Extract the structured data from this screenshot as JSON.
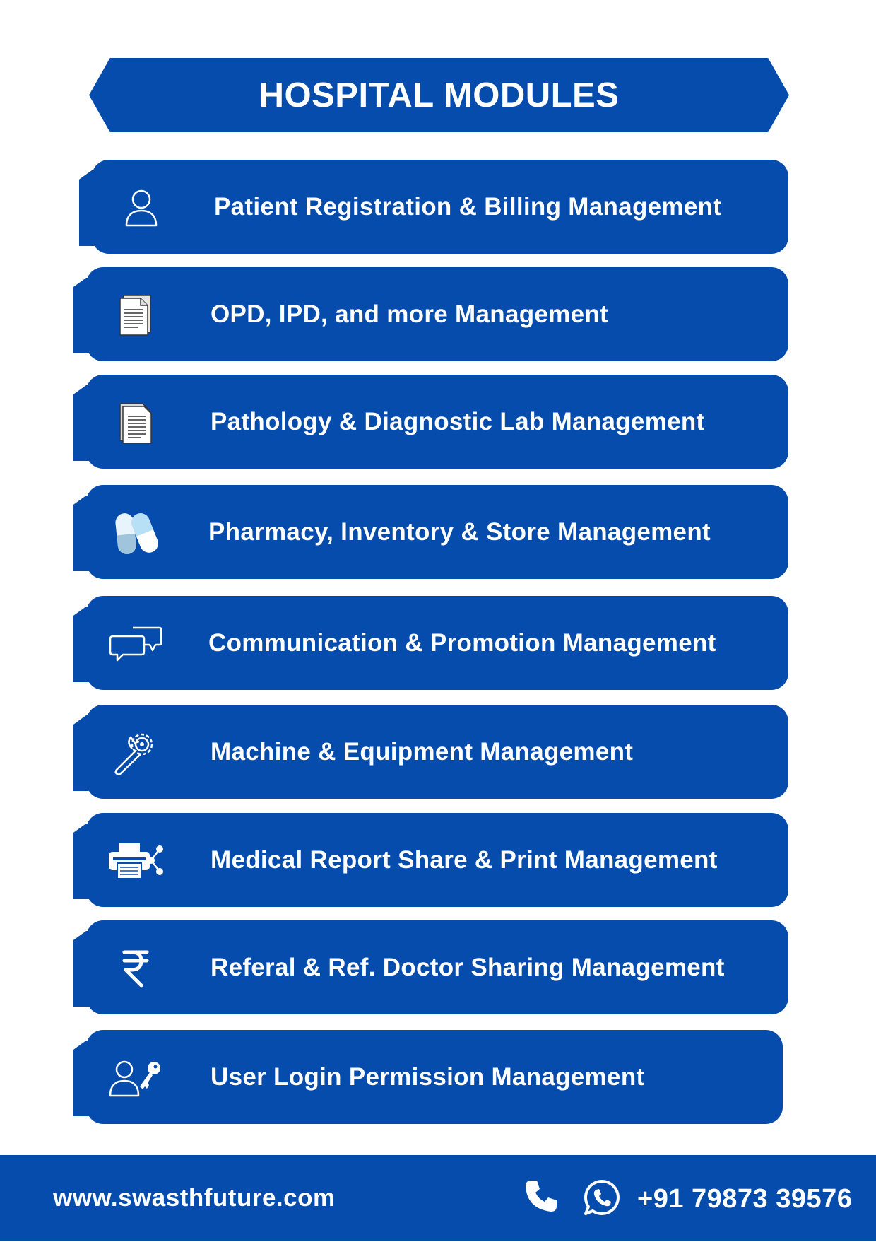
{
  "header": {
    "title": "HOSPITAL MODULES"
  },
  "modules": [
    {
      "label": "Patient Registration & Billing Management",
      "icon": "user-icon"
    },
    {
      "label": "OPD, IPD, and more Management",
      "icon": "document-icon"
    },
    {
      "label": "Pathology & Diagnostic Lab Management",
      "icon": "report-icon"
    },
    {
      "label": "Pharmacy, Inventory & Store Management",
      "icon": "capsule-icon"
    },
    {
      "label": "Communication & Promotion Management",
      "icon": "chat-bubbles-icon"
    },
    {
      "label": "Machine & Equipment Management",
      "icon": "gear-wrench-icon"
    },
    {
      "label": "Medical Report Share & Print Management",
      "icon": "printer-share-icon"
    },
    {
      "label": "Referal & Ref. Doctor Sharing Management",
      "icon": "rupee-icon"
    },
    {
      "label": "User Login Permission Management",
      "icon": "user-key-icon"
    }
  ],
  "footer": {
    "website": "www.swasthfuture.com",
    "phone": "+91 79873 39576",
    "phone_icon": "phone-icon",
    "whatsapp_icon": "whatsapp-icon"
  },
  "colors": {
    "primary": "#064cad",
    "text": "#ffffff",
    "background": "#ffffff"
  }
}
